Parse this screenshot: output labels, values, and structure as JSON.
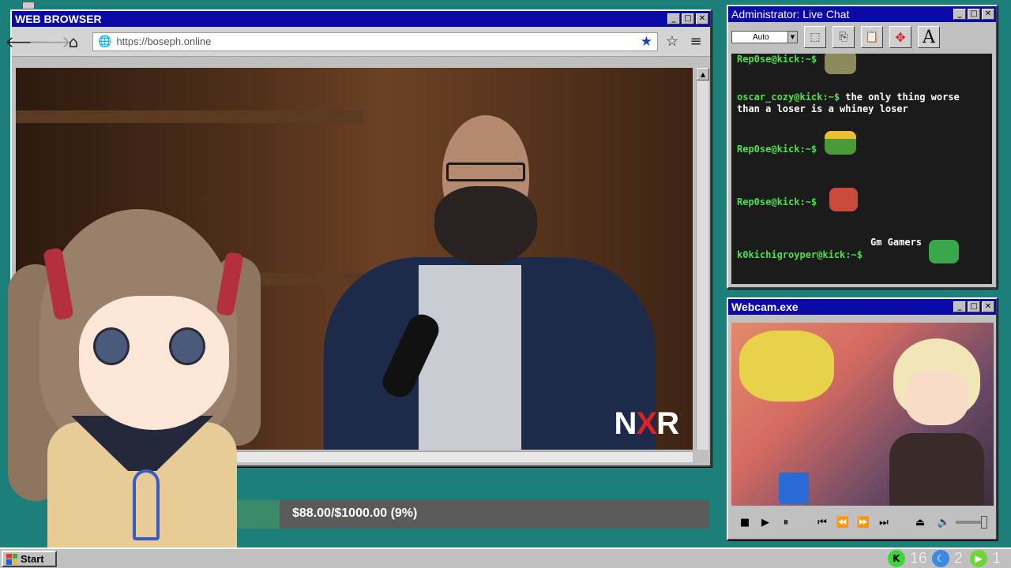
{
  "browser": {
    "title": "WEB BROWSER",
    "url": "https://boseph.online",
    "back_icon": "arrow-left",
    "forward_icon": "arrow-right",
    "home_icon": "home",
    "bookmark_icon": "star-filled",
    "favorites_icon": "star-outline",
    "menu_icon": "hamburger",
    "video_logo": {
      "left": "N",
      "mid": "X",
      "right": "R"
    }
  },
  "donation": {
    "text": "$88.00/$1000.00 (9%)",
    "progress_fraction": 0.09,
    "fill_color": "#3a8a6a"
  },
  "chat": {
    "title": "Administrator: Live Chat",
    "font_select": "Auto",
    "messages": [
      {
        "user": "Rep0se@kick:~$",
        "text": ""
      },
      {
        "user": "oscar_cozy@kick:~$",
        "text": "the only thing worse than a loser is a whiney loser"
      },
      {
        "user": "Rep0se@kick:~$",
        "text": ""
      },
      {
        "user": "Rep0se@kick:~$",
        "text": ""
      },
      {
        "user": "k0kichigroyper@kick:~$",
        "text": ""
      }
    ],
    "gm_text": "Gm Gamers"
  },
  "webcam": {
    "title": "Webcam.exe"
  },
  "taskbar": {
    "start_label": "Start",
    "tray": [
      {
        "icon": "kick-icon",
        "value": "16"
      },
      {
        "icon": "moon-icon",
        "value": "2"
      },
      {
        "icon": "play-icon",
        "value": "1"
      }
    ]
  },
  "colors": {
    "desktop": "#1c7f7a",
    "titlebar": "#0a0aa8",
    "chat_user": "#4ee04e"
  }
}
